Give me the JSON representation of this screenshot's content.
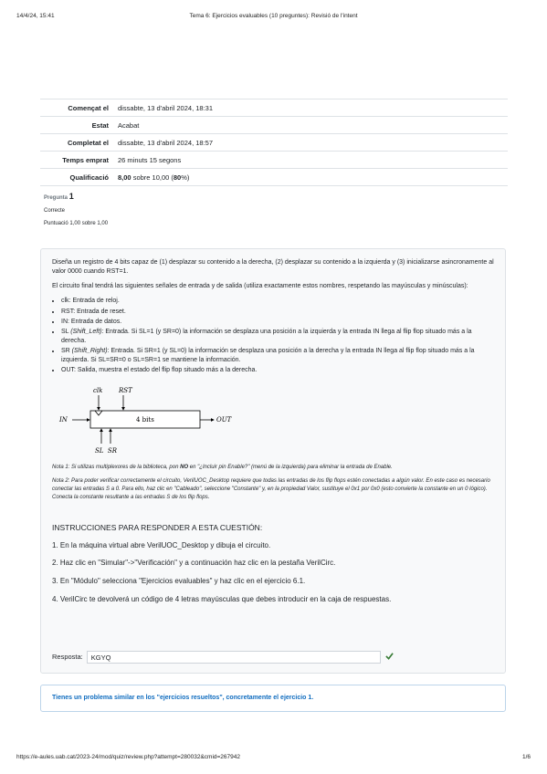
{
  "print_header": {
    "datetime": "14/4/24, 15:41",
    "title": "Tema 6: Ejercicios evaluables (10 preguntes): Revisió de l'intent"
  },
  "summary": [
    {
      "label": "Començat el",
      "value": "dissabte, 13 d'abril 2024, 18:31"
    },
    {
      "label": "Estat",
      "value": "Acabat"
    },
    {
      "label": "Completat el",
      "value": "dissabte, 13 d'abril 2024, 18:57"
    },
    {
      "label": "Temps emprat",
      "value": "26 minuts 15 segons"
    },
    {
      "label": "Qualificació",
      "value_grade": "8,00",
      "value_mid": " sobre 10,00 (",
      "value_pct": "80",
      "value_end": "%)"
    }
  ],
  "question_info": {
    "label": "Pregunta",
    "number": "1",
    "state": "Correcte",
    "grade": "Puntuació 1,00 sobre 1,00"
  },
  "question": {
    "intro": "Diseña un registro de 4 bits capaz de (1) desplazar su contenido a la derecha, (2) desplazar su contenido a la izquierda y (3) inicializarse asincronamente al valor 0000 cuando RST=1.",
    "signals_intro": "El circuito final tendrá las siguientes señales de entrada y de salida (utiliza exactamente estos nombres, respetando las mayúsculas y minúsculas):",
    "signals": [
      {
        "pre": "clk: Entrada de reloj.",
        "em": "",
        "post": ""
      },
      {
        "pre": "RST: Entrada de reset.",
        "em": "",
        "post": ""
      },
      {
        "pre": "IN: Entrada de datos.",
        "em": "",
        "post": ""
      },
      {
        "pre": "SL ",
        "em": "(Shift_Left)",
        "post": ": Entrada. Si SL=1 (y SR=0) la información se desplaza una posición a la izquierda y la entrada IN llega al flip flop situado más a la derecha."
      },
      {
        "pre": "SR ",
        "em": "(Shift_Right)",
        "post": ": Entrada. Si SR=1 (y SL=0) la información se desplaza una posición a la derecha y la entrada IN llega al flip flop situado más a la izquierda. Si SL=SR=0 o SL=SR=1 se mantiene la información."
      },
      {
        "pre": "OUT: Salida, muestra el estado del flip flop situado más a la derecha.",
        "em": "",
        "post": ""
      }
    ],
    "diagram": {
      "clk": "clk",
      "rst": "RST",
      "in": "IN",
      "block": "4 bits",
      "out": "OUT",
      "sl_sr": "SL  SR"
    },
    "note1_a": "Nota 1: Si utilizas multiplexores de la biblioteca, pon ",
    "note1_b": "NO",
    "note1_c": " en \"¿Incluir pin Enable?\" (menú de la izquierda) para eliminar la entrada de Enable.",
    "note2": "Nota 2: Para poder verificar correctamente el circuito, VerilUOC_Desktop requiere que todas las entradas de los flip flops estén conectadas a algún valor. En este caso es necesario conectar las entradas S a 0. Para ello, haz clic en \"Cableado\", seleccione \"Constante\" y, en la propiedad Valor, sustituye el 0x1 por 0x0 (esto convierte la constante en un 0 lógico). Conecta la constante resultante a las entradas S de los flip flops.",
    "instructions_title": "INSTRUCCIONES PARA RESPONDER A ESTA CUESTIÓN:",
    "instructions": [
      "1. En la máquina virtual abre VerilUOC_Desktop y dibuja el circuito.",
      "2. Haz clic en \"Simular\"->\"Verificación\" y a continuación haz clic en la pestaña VerilCirc.",
      "3. En \"Módulo\" selecciona \"Ejercicios evaluables\" y haz clic en el ejercicio 6.1.",
      "4. VerilCirc te devolverá un código de 4 letras mayúsculas que debes introducir en la caja de respuestas."
    ],
    "answer_label": "Resposta:",
    "answer_value": "KGYQ"
  },
  "feedback": "Tienes un problema similar en los \"ejercicios resueltos\",  concretamente el ejercicio 1.",
  "print_footer": {
    "url": "https://e-aules.uab.cat/2023-24/mod/quiz/review.php?attempt=280032&cmid=267942",
    "page": "1/6"
  },
  "colors": {
    "correct": "#357a32",
    "link": "#0f6cbf"
  }
}
